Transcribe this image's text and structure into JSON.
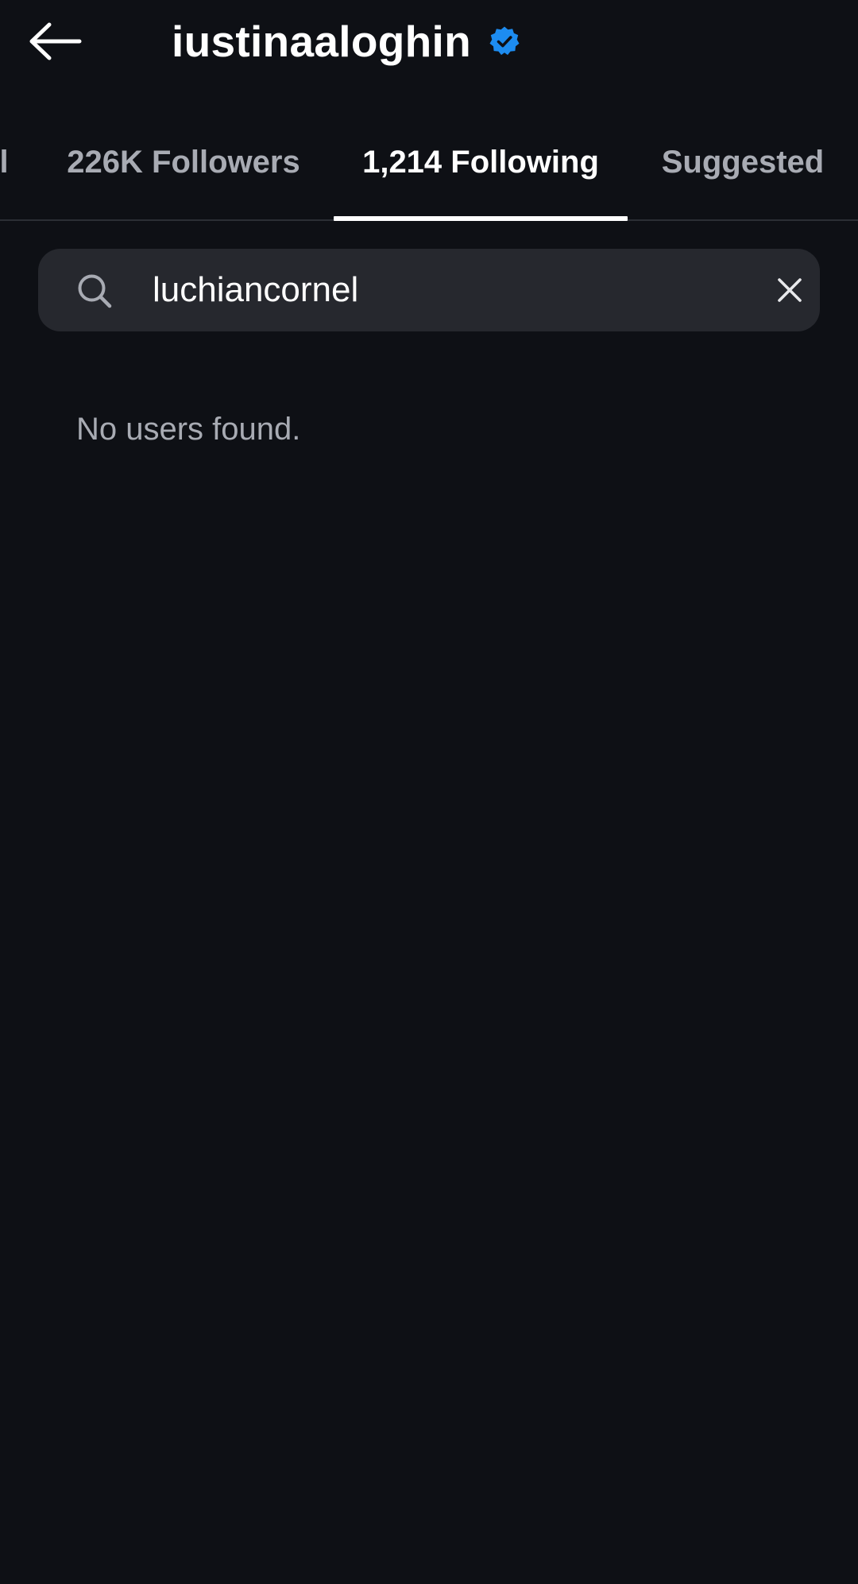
{
  "header": {
    "title": "iustinaaloghin",
    "back_icon": "arrow-left-icon",
    "verified_icon": "verified-badge-icon",
    "verified_color": "#1d8cf0"
  },
  "tabs": [
    {
      "label": "l",
      "active": false
    },
    {
      "label": "226K Followers",
      "active": false
    },
    {
      "label": "1,214 Following",
      "active": true
    },
    {
      "label": "Suggested",
      "active": false
    }
  ],
  "search": {
    "value": "luchiancornel",
    "icon": "search-icon",
    "clear_icon": "close-icon"
  },
  "results": {
    "empty_message": "No users found."
  },
  "colors": {
    "background": "#0e1015",
    "search_background": "#26282e",
    "active_tab": "#ffffff",
    "inactive_tab": "#a8abb3"
  }
}
